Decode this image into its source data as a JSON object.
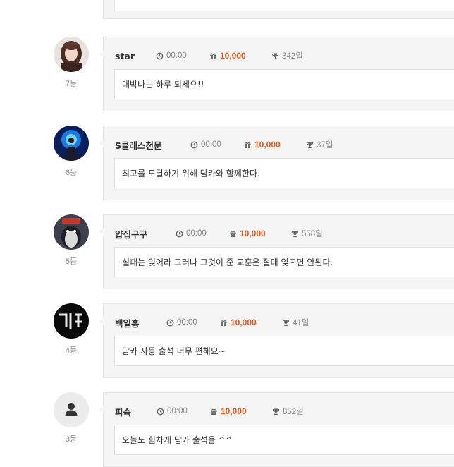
{
  "points_color": "#e0581d",
  "entries": [
    {
      "rank": "7등",
      "name": "star",
      "time": "00:00",
      "points": "10,000",
      "days": "342일",
      "message": "대박나는 하루 되세요!!",
      "avatar": "photo-woman"
    },
    {
      "rank": "6등",
      "name": "S클래스천문",
      "time": "00:00",
      "points": "10,000",
      "days": "37일",
      "message": "최고를 도달하기 위해 담카와 함께한다.",
      "avatar": "photo-blue-glow"
    },
    {
      "rank": "5등",
      "name": "얍집구구",
      "time": "00:00",
      "points": "10,000",
      "days": "558일",
      "message": "실패는 잊어라 그러나 그것이 준 교훈은 절대 잊으면 안된다.",
      "avatar": "photo-penguin"
    },
    {
      "rank": "4등",
      "name": "백일홍",
      "time": "00:00",
      "points": "10,000",
      "days": "41일",
      "message": "담카 자동 출석 너무 편해요~",
      "avatar": "photo-neon-text"
    },
    {
      "rank": "3등",
      "name": "피슉",
      "time": "00:00",
      "points": "10,000",
      "days": "852일",
      "message": "오늘도 힘차게 담카 출석을 ^^",
      "avatar": "default-user-icon"
    }
  ]
}
